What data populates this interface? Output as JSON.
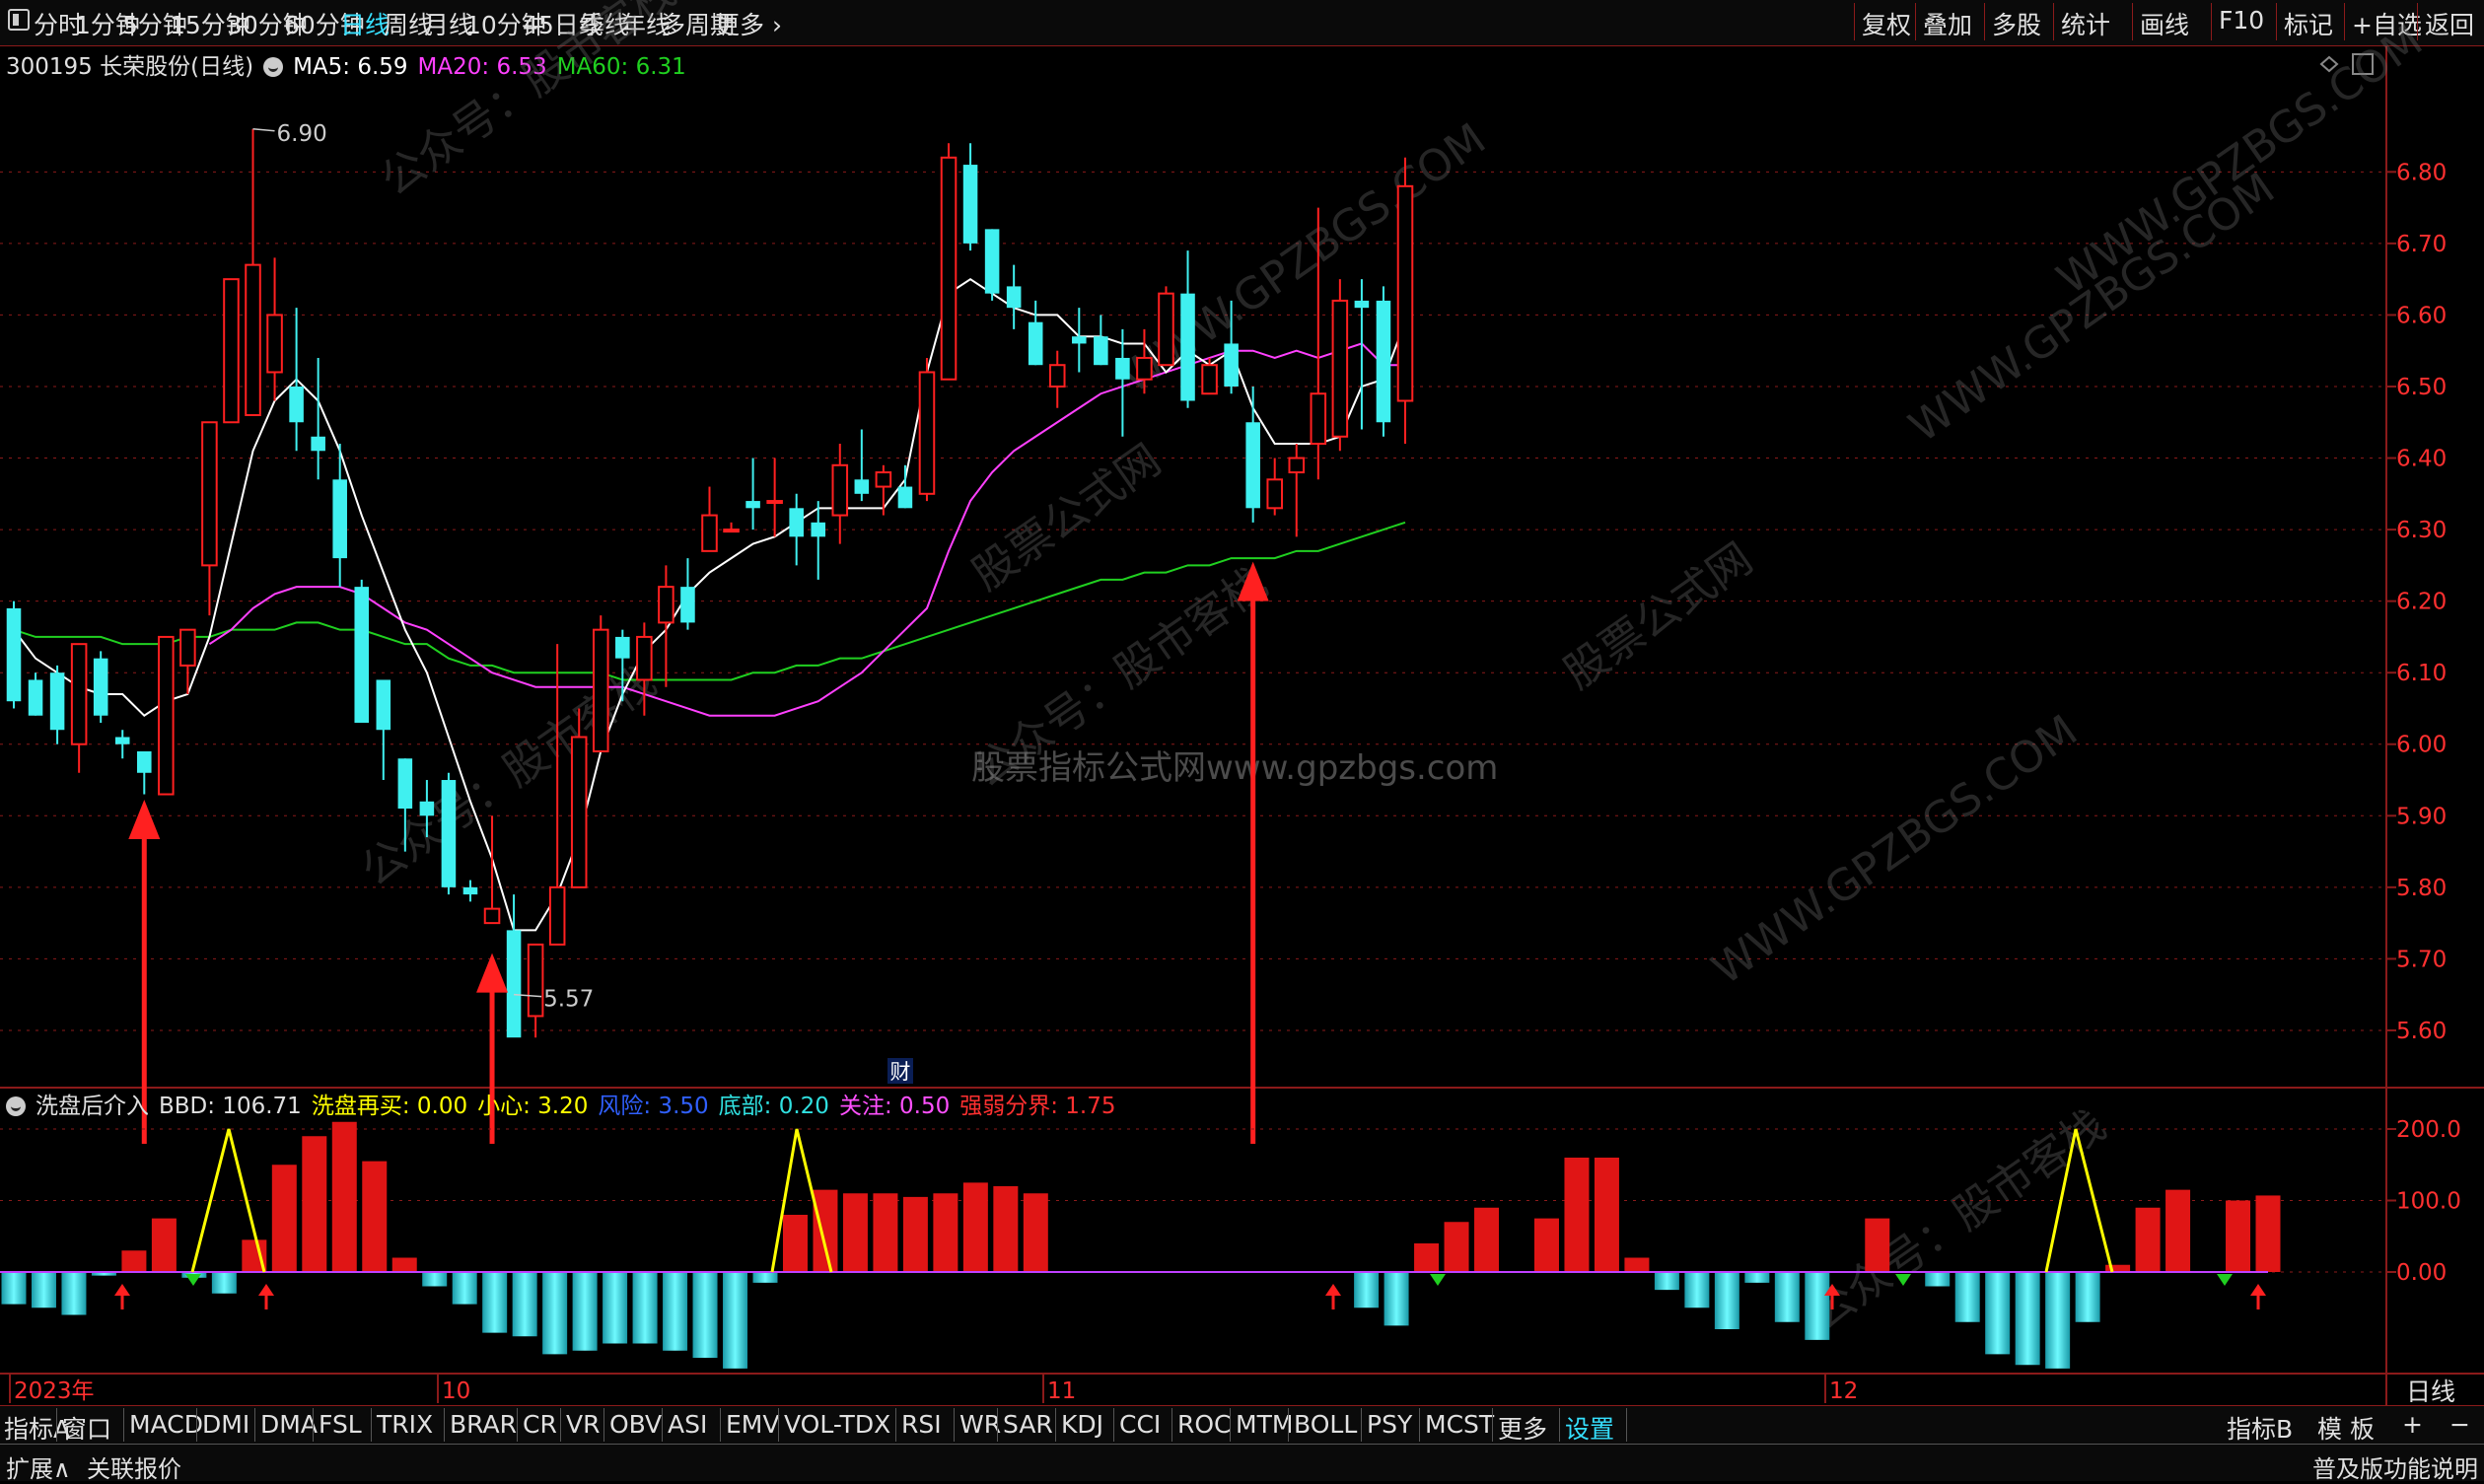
{
  "toolbar": {
    "periods": [
      "分时",
      "1分钟",
      "5分钟",
      "15分钟",
      "30分钟",
      "60分钟",
      "日线",
      "周线",
      "月线",
      "10分钟",
      "45日线",
      "季线",
      "年线",
      "多周期",
      "更多"
    ],
    "active_period": "日线",
    "right_items": [
      "复权",
      "叠加",
      "多股",
      "统计",
      "画线",
      "F10",
      "标记",
      "+自选",
      "返回"
    ]
  },
  "header": {
    "stock": "300195 长荣股份(日线)",
    "ma5_label": "MA5: 6.59",
    "ma20_label": "MA20: 6.53",
    "ma60_label": "MA60: 6.31"
  },
  "annotations": {
    "high": "6.90",
    "low": "5.57",
    "cai": "财"
  },
  "indicator": {
    "name": "洗盘后介入",
    "items": [
      {
        "text": "BBD: 106.71",
        "color": "#e0e0e0"
      },
      {
        "text": "洗盘再买: 0.00",
        "color": "#ffff00"
      },
      {
        "text": "小心: 3.20",
        "color": "#ffff00"
      },
      {
        "text": "风险: 3.50",
        "color": "#3060ff"
      },
      {
        "text": "底部: 0.20",
        "color": "#30e0e0"
      },
      {
        "text": "关注: 0.50",
        "color": "#ff50ff"
      },
      {
        "text": "强弱分界: 1.75",
        "color": "#ff3030"
      }
    ],
    "yticks": [
      "200.0",
      "100.0",
      "0.00"
    ]
  },
  "time_axis": {
    "labels": [
      "2023年",
      "10",
      "11",
      "12"
    ],
    "right": "日线"
  },
  "bottom_tabs": [
    "指标A",
    "窗口",
    "MACD",
    "DMI",
    "DMA",
    "FSL",
    "TRIX",
    "BRAR",
    "CR",
    "VR",
    "OBV",
    "ASI",
    "EMV",
    "VOL-TDX",
    "RSI",
    "WR",
    "SAR",
    "KDJ",
    "CCI",
    "ROC",
    "MTM",
    "BOLL",
    "PSY",
    "MCST",
    "更多",
    "设置"
  ],
  "bottom_right": [
    "指标B",
    "模 板",
    "+",
    "−"
  ],
  "status": {
    "left": [
      "扩展∧",
      "关联报价"
    ],
    "right": "普及版功能说明"
  },
  "watermarks": [
    "公众号：股市客栈",
    "WWW.GPZBGS.COM",
    "股票公式网",
    "股票指标公式网www.gpzbgs.com"
  ],
  "colors": {
    "up": "#ff2020",
    "down": "#40f0f0",
    "ma5": "#ffffff",
    "ma20": "#ff40ff",
    "ma60": "#20d020",
    "grid": "#8b1a1a"
  },
  "chart_data": {
    "type": "candlestick",
    "ylim": [
      5.52,
      6.93
    ],
    "yticks": [
      5.6,
      5.7,
      5.8,
      5.9,
      6.0,
      6.1,
      6.2,
      6.3,
      6.4,
      6.5,
      6.6,
      6.7,
      6.8
    ],
    "ohlc": [
      [
        6.19,
        6.2,
        6.05,
        6.06
      ],
      [
        6.09,
        6.1,
        6.04,
        6.04
      ],
      [
        6.1,
        6.11,
        6.0,
        6.02
      ],
      [
        6.0,
        6.14,
        5.96,
        6.14
      ],
      [
        6.12,
        6.13,
        6.03,
        6.04
      ],
      [
        6.01,
        6.02,
        5.98,
        6.0
      ],
      [
        5.99,
        5.99,
        5.93,
        5.96
      ],
      [
        5.93,
        6.15,
        5.93,
        6.15
      ],
      [
        6.11,
        6.16,
        6.07,
        6.16
      ],
      [
        6.25,
        6.28,
        6.18,
        6.45
      ],
      [
        6.45,
        6.62,
        6.45,
        6.65
      ],
      [
        6.46,
        6.86,
        6.46,
        6.67
      ],
      [
        6.52,
        6.68,
        6.48,
        6.6
      ],
      [
        6.5,
        6.61,
        6.41,
        6.45
      ],
      [
        6.43,
        6.54,
        6.37,
        6.41
      ],
      [
        6.37,
        6.42,
        6.22,
        6.26
      ],
      [
        6.22,
        6.23,
        6.07,
        6.03
      ],
      [
        6.09,
        6.05,
        5.95,
        6.02
      ],
      [
        5.98,
        5.98,
        5.85,
        5.91
      ],
      [
        5.92,
        5.95,
        5.87,
        5.9
      ],
      [
        5.95,
        5.96,
        5.79,
        5.8
      ],
      [
        5.8,
        5.81,
        5.78,
        5.79
      ],
      [
        5.75,
        5.9,
        5.75,
        5.77
      ],
      [
        5.74,
        5.79,
        5.65,
        5.59
      ],
      [
        5.62,
        5.72,
        5.59,
        5.72
      ],
      [
        5.72,
        6.14,
        5.72,
        5.8
      ],
      [
        5.8,
        6.05,
        5.8,
        6.01
      ],
      [
        5.99,
        6.18,
        5.99,
        6.16
      ],
      [
        6.15,
        6.16,
        6.06,
        6.12
      ],
      [
        6.09,
        6.17,
        6.04,
        6.15
      ],
      [
        6.17,
        6.25,
        6.08,
        6.22
      ],
      [
        6.22,
        6.26,
        6.16,
        6.17
      ],
      [
        6.27,
        6.36,
        6.27,
        6.32
      ],
      [
        6.3,
        6.31,
        6.3,
        6.3
      ],
      [
        6.34,
        6.4,
        6.3,
        6.33
      ],
      [
        6.34,
        6.4,
        6.29,
        6.34
      ],
      [
        6.33,
        6.35,
        6.25,
        6.29
      ],
      [
        6.31,
        6.34,
        6.23,
        6.29
      ],
      [
        6.32,
        6.42,
        6.28,
        6.39
      ],
      [
        6.37,
        6.44,
        6.34,
        6.35
      ],
      [
        6.36,
        6.39,
        6.32,
        6.38
      ],
      [
        6.36,
        6.39,
        6.33,
        6.33
      ],
      [
        6.35,
        6.54,
        6.34,
        6.52
      ],
      [
        6.51,
        6.84,
        6.51,
        6.82
      ],
      [
        6.81,
        6.84,
        6.69,
        6.7
      ],
      [
        6.72,
        6.72,
        6.62,
        6.63
      ],
      [
        6.64,
        6.67,
        6.58,
        6.61
      ],
      [
        6.59,
        6.62,
        6.53,
        6.53
      ],
      [
        6.5,
        6.55,
        6.47,
        6.53
      ],
      [
        6.57,
        6.61,
        6.52,
        6.56
      ],
      [
        6.57,
        6.6,
        6.53,
        6.53
      ],
      [
        6.54,
        6.58,
        6.43,
        6.51
      ],
      [
        6.51,
        6.58,
        6.49,
        6.54
      ],
      [
        6.53,
        6.64,
        6.53,
        6.63
      ],
      [
        6.63,
        6.69,
        6.47,
        6.48
      ],
      [
        6.49,
        6.54,
        6.49,
        6.53
      ],
      [
        6.56,
        6.62,
        6.49,
        6.5
      ],
      [
        6.45,
        6.5,
        6.31,
        6.33
      ],
      [
        6.33,
        6.4,
        6.32,
        6.37
      ],
      [
        6.38,
        6.42,
        6.29,
        6.4
      ],
      [
        6.42,
        6.75,
        6.37,
        6.49
      ],
      [
        6.43,
        6.65,
        6.41,
        6.62
      ],
      [
        6.62,
        6.65,
        6.44,
        6.61
      ],
      [
        6.62,
        6.64,
        6.43,
        6.45
      ],
      [
        6.48,
        6.82,
        6.42,
        6.78
      ]
    ],
    "ma5": [
      6.16,
      6.12,
      6.1,
      6.08,
      6.07,
      6.07,
      6.04,
      6.06,
      6.07,
      6.15,
      6.28,
      6.41,
      6.48,
      6.51,
      6.48,
      6.41,
      6.32,
      6.24,
      6.16,
      6.1,
      6.01,
      5.92,
      5.84,
      5.74,
      5.74,
      5.79,
      5.87,
      5.99,
      6.07,
      6.13,
      6.16,
      6.21,
      6.24,
      6.26,
      6.28,
      6.29,
      6.31,
      6.33,
      6.33,
      6.33,
      6.33,
      6.37,
      6.52,
      6.63,
      6.65,
      6.63,
      6.61,
      6.6,
      6.6,
      6.57,
      6.57,
      6.56,
      6.56,
      6.52,
      6.55,
      6.53,
      6.55,
      6.47,
      6.42,
      6.42,
      6.42,
      6.43,
      6.5,
      6.51,
      6.59
    ],
    "ma20": [
      null,
      null,
      null,
      null,
      null,
      null,
      null,
      null,
      null,
      6.14,
      6.16,
      6.19,
      6.21,
      6.22,
      6.22,
      6.22,
      6.21,
      6.19,
      6.17,
      6.16,
      6.14,
      6.12,
      6.1,
      6.09,
      6.08,
      6.08,
      6.08,
      6.08,
      6.08,
      6.07,
      6.06,
      6.05,
      6.04,
      6.04,
      6.04,
      6.04,
      6.05,
      6.06,
      6.08,
      6.1,
      6.13,
      6.16,
      6.19,
      6.27,
      6.34,
      6.38,
      6.41,
      6.43,
      6.45,
      6.47,
      6.49,
      6.5,
      6.51,
      6.52,
      6.53,
      6.54,
      6.55,
      6.55,
      6.54,
      6.55,
      6.54,
      6.55,
      6.56,
      6.53,
      6.53
    ],
    "ma60": [
      6.16,
      6.15,
      6.15,
      6.15,
      6.15,
      6.14,
      6.14,
      6.14,
      6.15,
      6.15,
      6.16,
      6.16,
      6.16,
      6.17,
      6.17,
      6.16,
      6.16,
      6.15,
      6.14,
      6.14,
      6.12,
      6.11,
      6.11,
      6.1,
      6.1,
      6.1,
      6.1,
      6.1,
      6.09,
      6.09,
      6.09,
      6.09,
      6.09,
      6.09,
      6.1,
      6.1,
      6.11,
      6.11,
      6.12,
      6.12,
      6.13,
      6.14,
      6.15,
      6.16,
      6.17,
      6.18,
      6.19,
      6.2,
      6.21,
      6.22,
      6.23,
      6.23,
      6.24,
      6.24,
      6.25,
      6.25,
      6.26,
      6.26,
      6.26,
      6.27,
      6.27,
      6.28,
      6.29,
      6.3,
      6.31
    ],
    "arrows_price": [
      6,
      22,
      57
    ],
    "bbd": [
      -45,
      -50,
      -60,
      -5,
      30,
      75,
      -8,
      -30,
      45,
      150,
      190,
      210,
      155,
      20,
      -20,
      -45,
      -85,
      -90,
      -115,
      -110,
      -100,
      -100,
      -110,
      -120,
      -135,
      -15,
      80,
      115,
      110,
      110,
      105,
      110,
      125,
      120,
      110,
      0,
      0,
      0,
      0,
      0,
      0,
      0,
      0,
      0,
      0,
      -50,
      -75,
      40,
      70,
      90,
      0,
      75,
      160,
      160,
      20,
      -25,
      -50,
      -80,
      -15,
      -70,
      -95,
      0,
      75,
      0,
      -20,
      -70,
      -115,
      -130,
      -135,
      -70,
      10,
      90,
      115,
      0,
      100,
      107
    ],
    "bbd_x_start": 0,
    "signals": {
      "peaks": [
        6,
        22,
        57
      ],
      "up_arrows": [
        3,
        7,
        38,
        52,
        64
      ],
      "down_arrows": [
        5,
        41,
        54,
        63
      ]
    }
  }
}
